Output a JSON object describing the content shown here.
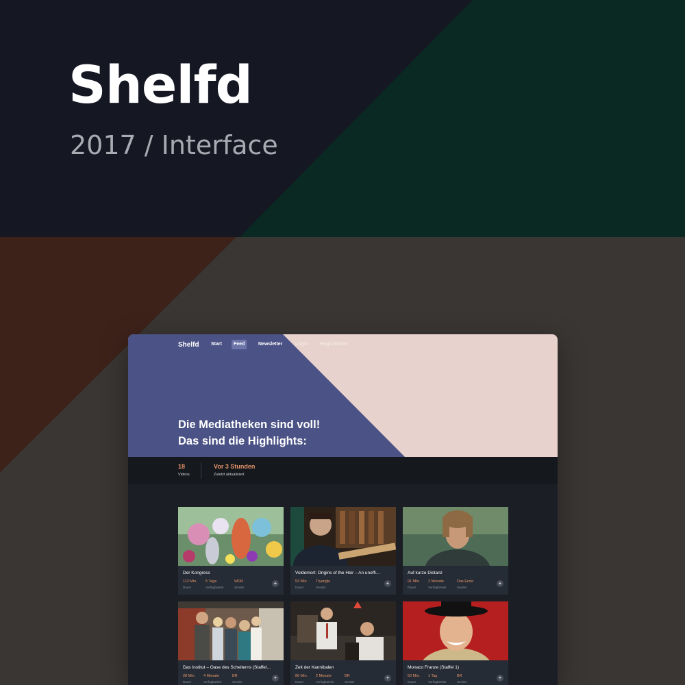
{
  "hero": {
    "title": "Shelfd",
    "subtitle": "2017 / Interface"
  },
  "colors": {
    "navy": "#151723",
    "forest": "#0a2922",
    "rust": "#3d221a",
    "taupe": "#3a3633",
    "app_indigo": "#4b5285",
    "app_blush": "#e7d2cd",
    "app_dark": "#1b1f25",
    "accent_orange": "#e8956a"
  },
  "app": {
    "logo": "Shelfd",
    "nav": [
      {
        "label": "Start"
      },
      {
        "label": "Feed"
      },
      {
        "label": "Newsletter"
      },
      {
        "label": "Login"
      },
      {
        "label": "Registrieren"
      }
    ],
    "headline": [
      "Die Mediatheken sind voll!",
      "Das sind die Highlights:"
    ],
    "stats": [
      {
        "value": "18",
        "label": "Videos"
      },
      {
        "value": "Vor 3 Stunden",
        "label": "Zuletzt aktualisiert"
      }
    ],
    "meta_labels": [
      "Dauer",
      "Verfügbarkeit",
      "Sender"
    ],
    "cards": [
      {
        "title": "Der Kongress",
        "duration": "112 Min.",
        "availability": "5 Tage",
        "channel": "WDR"
      },
      {
        "title": "Voldemort: Origins of the Heir – An unoffi…",
        "duration": "53 Min.",
        "availability": "Tryangle",
        "channel": ""
      },
      {
        "title": "Auf kurze Distanz",
        "duration": "91 Min.",
        "availability": "2 Monate",
        "channel": "Das Erste"
      },
      {
        "title": "Das Institut – Oase des Scheiterns (Staffel…",
        "duration": "28 Min.",
        "availability": "4 Monate",
        "channel": "BR"
      },
      {
        "title": "Zeit der Kannibalen",
        "duration": "86 Min.",
        "availability": "2 Monate",
        "channel": "BR"
      },
      {
        "title": "Monaco Franze (Staffel 1)",
        "duration": "50 Min.",
        "availability": "1 Tag",
        "channel": "BR"
      }
    ]
  }
}
